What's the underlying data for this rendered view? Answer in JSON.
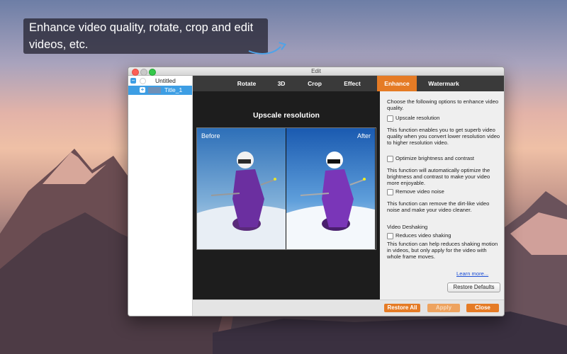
{
  "caption": {
    "text": "Enhance video quality, rotate, crop and edit videos, etc."
  },
  "window": {
    "title": "Edit"
  },
  "sidebar": {
    "items": [
      {
        "label": "Untitled"
      },
      {
        "label": "Title_1"
      }
    ]
  },
  "tabs": [
    {
      "label": "Rotate"
    },
    {
      "label": "3D"
    },
    {
      "label": "Crop"
    },
    {
      "label": "Effect"
    },
    {
      "label": "Enhance",
      "active": true
    },
    {
      "label": "Watermark"
    }
  ],
  "preview": {
    "title": "Upscale resolution",
    "before_label": "Before",
    "after_label": "After"
  },
  "options": {
    "intro": "Choose the following options to enhance video quality.",
    "upscale": {
      "label": "Upscale resolution",
      "checked": false,
      "desc": "This function enables you to get superb video quality when you convert lower resolution video to higher resolution video."
    },
    "brightness": {
      "label": "Optimize brightness and contrast",
      "checked": false,
      "desc": "This function will automatically optimize the brightness and contrast to make your video more enjoyable."
    },
    "noise": {
      "label": "Remove video noise",
      "checked": false,
      "desc": "This function can remove the dirt-like video noise and make your video cleaner."
    },
    "deshake_heading": "Video Deshaking",
    "deshake": {
      "label": "Reduces video shaking",
      "checked": false,
      "desc": "This function can help reduces shaking motion in videos, but only apply for the video with whole frame moves."
    },
    "learn_more": "Learn more...",
    "restore_defaults": "Restore Defaults"
  },
  "footer": {
    "restore_all": "Restore All",
    "apply": "Apply",
    "close": "Close"
  },
  "colors": {
    "accent": "#e57b25",
    "selection": "#3d9ee4",
    "tab_bar": "#3a3a3a"
  }
}
